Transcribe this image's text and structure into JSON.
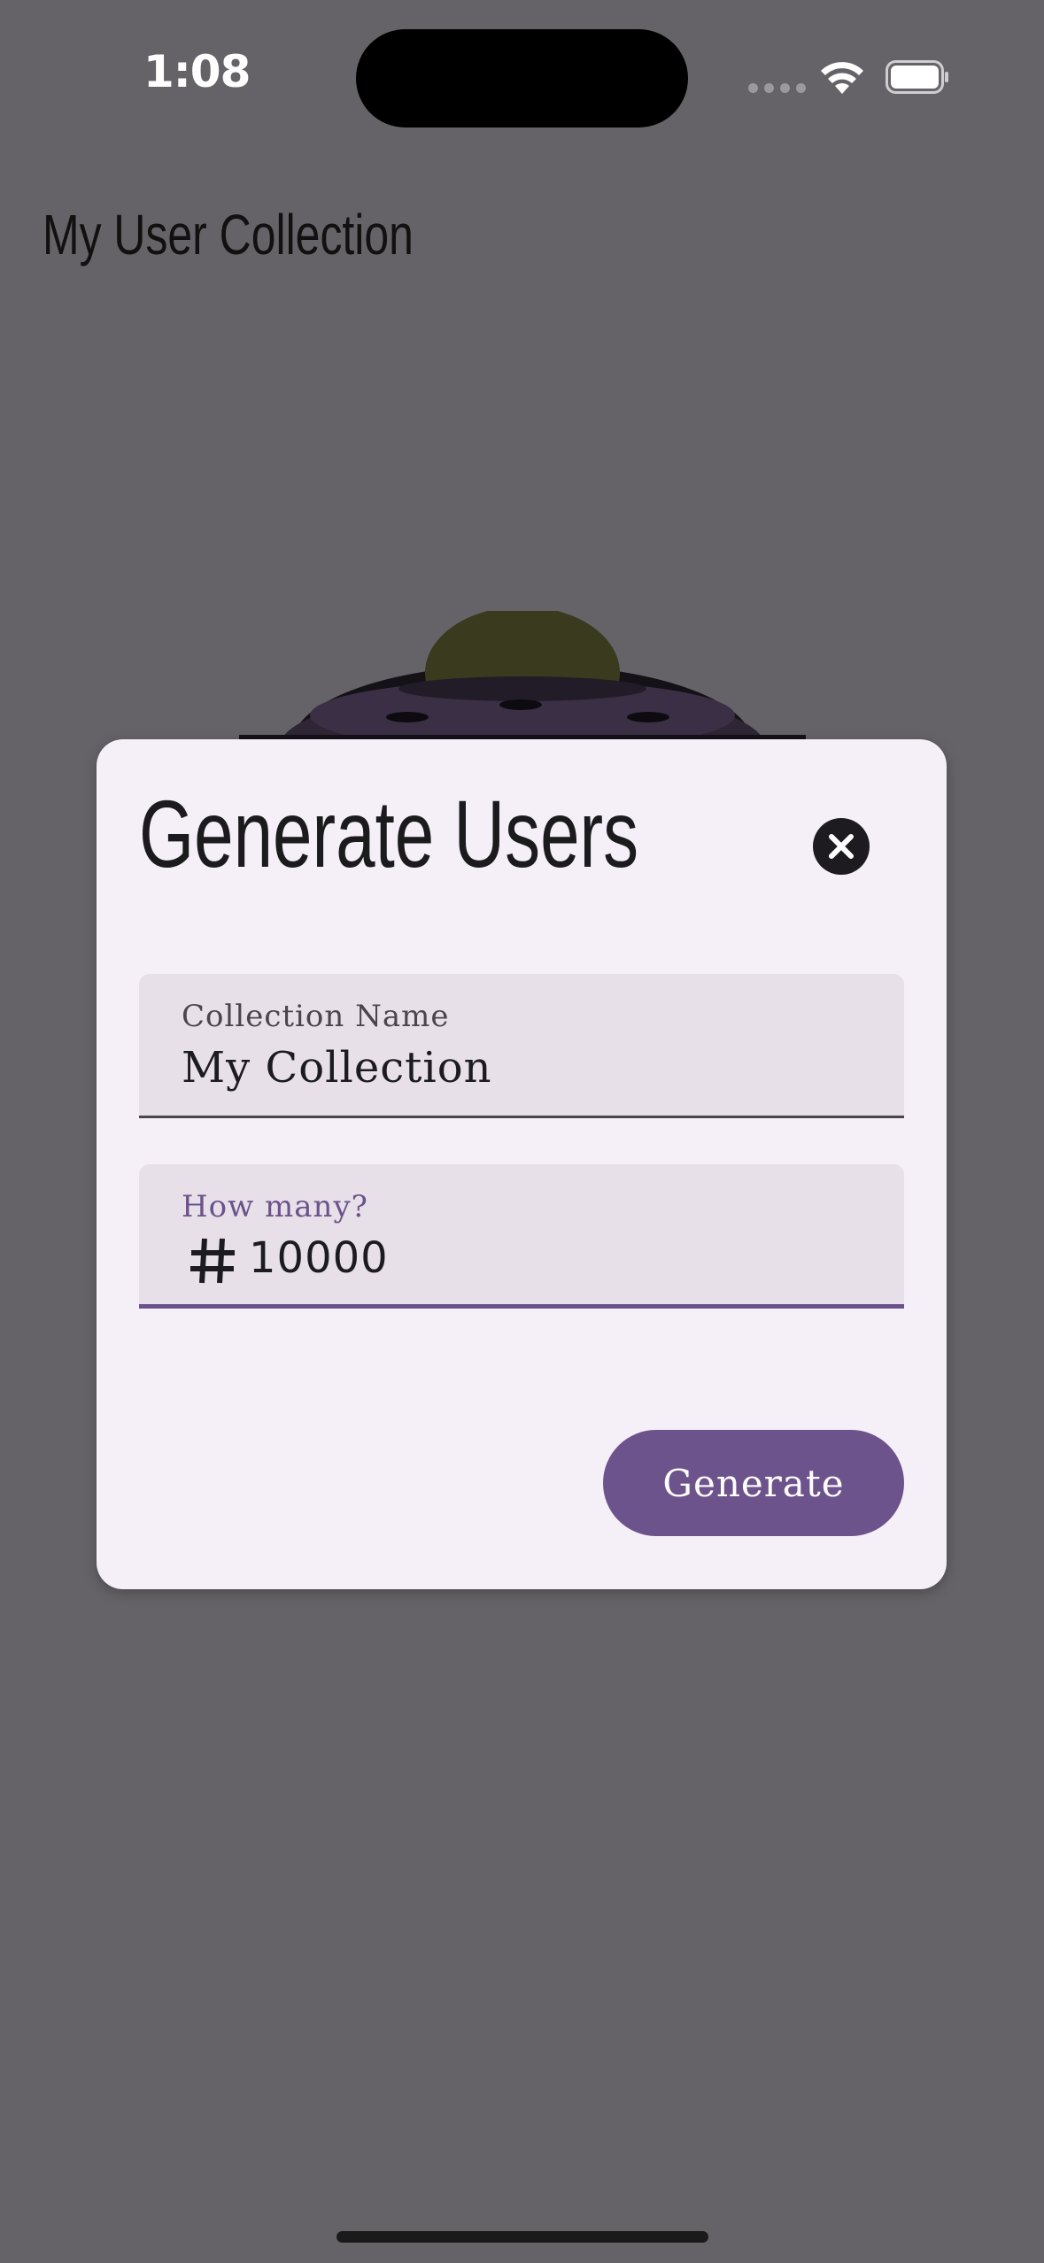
{
  "status_bar": {
    "time": "1:08"
  },
  "app_bar": {
    "title": "My User Collection"
  },
  "dialog": {
    "title": "Generate Users",
    "close_icon": "close-icon",
    "fields": {
      "collection_name": {
        "label": "Collection Name",
        "value": "My Collection"
      },
      "count": {
        "label": "How many?",
        "icon": "hash-icon",
        "value": "10000"
      }
    },
    "generate_label": "Generate"
  },
  "colors": {
    "scrim": "#656367",
    "dialog_bg": "#f5eff7",
    "field_bg": "#e7e0e8",
    "accent": "#6d538b"
  }
}
